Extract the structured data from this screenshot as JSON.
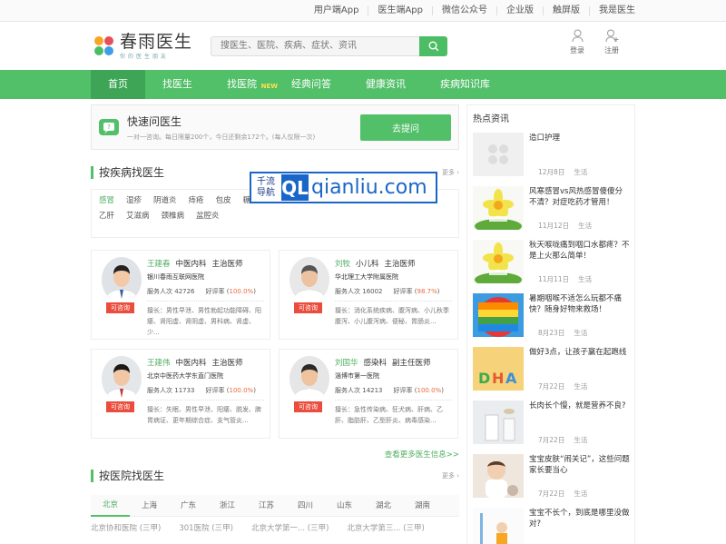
{
  "topbar": {
    "links": [
      "用户端App",
      "医生端App",
      "微信公众号",
      "企业版",
      "触屏版",
      "我是医生"
    ]
  },
  "logo": {
    "title": "春雨医生",
    "subtitle": "你的医生朋友"
  },
  "search": {
    "placeholder": "搜医生、医院、疾病、症状、资讯"
  },
  "account": {
    "login": "登录",
    "register": "注册"
  },
  "nav": {
    "items": [
      "首页",
      "找医生",
      "找医院",
      "经典问答",
      "健康资讯",
      "疾病知识库"
    ],
    "new_badge": "NEW"
  },
  "quick": {
    "title": "快速问医生",
    "desc": "一对一咨询。每日限量200个，今日还剩余172个。(每人仅限一次)",
    "button": "去提问"
  },
  "disease_section": {
    "title": "按疾病找医生",
    "more": "更多",
    "tags": [
      "感冒",
      "湿疹",
      "阴道炎",
      "痔疮",
      "包皮",
      "糖尿病",
      "宫颈糜烂",
      "高血压",
      "肺炎",
      "鼻炎",
      "宫外孕",
      "乙肝",
      "艾滋病",
      "颈椎病",
      "盆腔炎"
    ]
  },
  "doctors": [
    {
      "name": "王建春",
      "dept": "中医内科",
      "title": "主治医师",
      "hospital": "银川春雨互联网医院",
      "served_label": "服务人次",
      "served": "42726",
      "rate_label": "好评率",
      "rate": "100.0%",
      "skill": "擅长：男性早泄、男性勃起功能障碍、阳痿、肾阳虚、肾阴虚、男科病、肾虚、少...",
      "ask": "可咨询"
    },
    {
      "name": "刘牧",
      "dept": "小儿科",
      "title": "主治医师",
      "hospital": "华北理工大学附属医院",
      "served_label": "服务人次",
      "served": "16002",
      "rate_label": "好评率",
      "rate": "98.7%",
      "skill": "擅长：消化系统疾病、腹泻病、小儿秋季腹泻、小儿腹泻病、便秘、胃肠炎...",
      "ask": "可咨询"
    },
    {
      "name": "王建伟",
      "dept": "中医内科",
      "title": "主治医师",
      "hospital": "北京中医药大学东直门医院",
      "served_label": "服务人次",
      "served": "11733",
      "rate_label": "好评率",
      "rate": "100.0%",
      "skill": "擅长：失眠、男性早泄、阳痿、脱发、脾胃病证、更年期综合症、支气管炎...",
      "ask": "可咨询"
    },
    {
      "name": "刘国华",
      "dept": "感染科",
      "title": "副主任医师",
      "hospital": "淄博市第一医院",
      "served_label": "服务人次",
      "served": "14213",
      "rate_label": "好评率",
      "rate": "100.0%",
      "skill": "擅长：急性传染病、狂犬病、肝病、乙肝、脂肪肝、乙型肝炎、病毒感染...",
      "ask": "可咨询"
    }
  ],
  "see_more_doctors": "查看更多医生信息>>",
  "hospital_section": {
    "title": "按医院找医生",
    "more": "更多",
    "cities": [
      "北京",
      "上海",
      "广东",
      "浙江",
      "江苏",
      "四川",
      "山东",
      "湖北",
      "湖南"
    ],
    "hospitals": [
      {
        "name": "北京协和医院",
        "level": "(三甲)"
      },
      {
        "name": "301医院",
        "level": "(三甲)"
      },
      {
        "name": "北京大学第一...",
        "level": "(三甲)"
      },
      {
        "name": "北京大学第三...",
        "level": "(三甲)"
      }
    ]
  },
  "hot": {
    "title": "热点资讯",
    "news": [
      {
        "title": "造口护理",
        "date": "12月8日",
        "cat": "生活",
        "img": "placeholder"
      },
      {
        "title": "风寒感冒vs风热感冒傻傻分不清？对症吃药才管用！",
        "date": "11月12日",
        "cat": "生活",
        "img": "flower"
      },
      {
        "title": "秋天喉咙痛到咽口水都疼？不是上火那么简单！",
        "date": "11月11日",
        "cat": "生活",
        "img": "flower"
      },
      {
        "title": "暑期咽喉不适怎么玩都不痛快？随身好物来救场！",
        "date": "8月23日",
        "cat": "生活",
        "img": "rainbow"
      },
      {
        "title": "做好3点，让孩子赢在起跑线",
        "date": "7月22日",
        "cat": "生活",
        "img": "dha"
      },
      {
        "title": "长肉长个慢，就是营养不良?",
        "date": "7月22日",
        "cat": "生活",
        "img": "milk"
      },
      {
        "title": "宝宝皮肤“闹关记”，这些问题家长要当心",
        "date": "7月22日",
        "cat": "生活",
        "img": "baby"
      },
      {
        "title": "宝宝不长个，到底是哪里没做对?",
        "date": "",
        "cat": "",
        "img": "kid"
      }
    ]
  },
  "watermark": {
    "cn1": "千流",
    "cn2": "导航",
    "ql": "QL",
    "domain": "qianliu.com"
  }
}
